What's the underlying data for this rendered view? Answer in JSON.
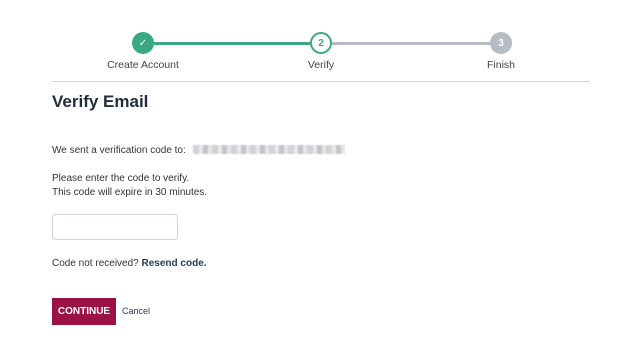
{
  "stepper": {
    "steps": [
      {
        "number": "✓",
        "label": "Create Account"
      },
      {
        "number": "2",
        "label": "Verify"
      },
      {
        "number": "3",
        "label": "Finish"
      }
    ]
  },
  "main": {
    "title": "Verify Email",
    "sent_text": "We sent a verification code to:",
    "instruction_1": "Please enter the code to verify.",
    "instruction_2": "This code will expire in 30 minutes.",
    "code_input_value": "",
    "not_received_text": "Code not received?",
    "resend_label": "Resend code.",
    "continue_label": "CONTINUE",
    "cancel_label": "Cancel"
  },
  "colors": {
    "accent_green": "#3aa981",
    "inactive_gray": "#b5bcc6",
    "primary_button": "#9b1045",
    "heading": "#1f2d3d"
  }
}
